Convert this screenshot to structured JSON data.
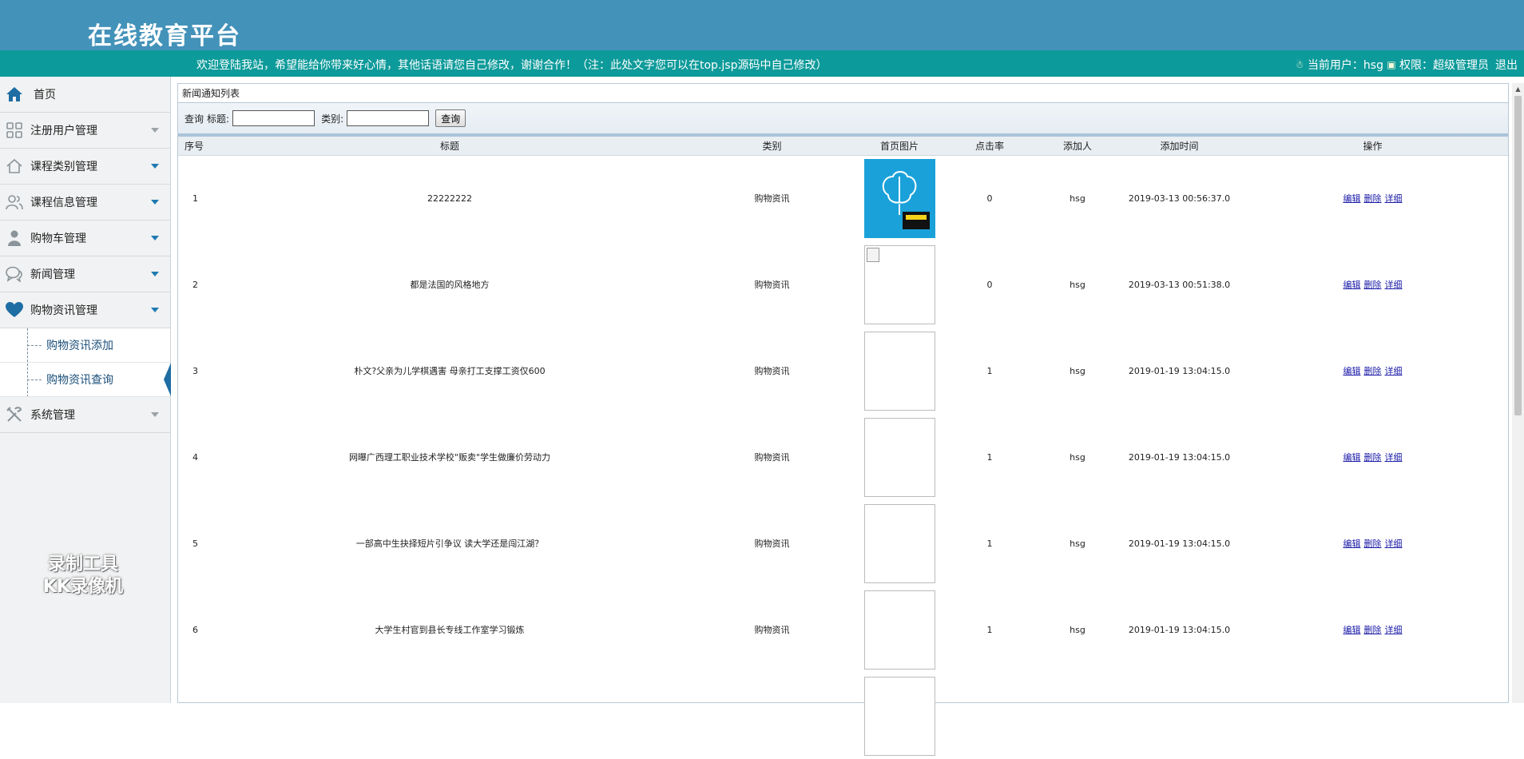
{
  "header": {
    "app_title": "在线教育平台",
    "welcome": "欢迎登陆我站，希望能给你带来好心情，其他话语请您自己修改，谢谢合作！（注：此处文字您可以在top.jsp源码中自己修改）",
    "current_user_label": "当前用户：hsg",
    "permission_label": "权限：超级管理员",
    "logout_label": "退出"
  },
  "sidebar": {
    "home": "首页",
    "items": [
      {
        "label": "注册用户管理",
        "icon": "grid-icon"
      },
      {
        "label": "课程类别管理",
        "icon": "home-icon"
      },
      {
        "label": "课程信息管理",
        "icon": "users-icon"
      },
      {
        "label": "购物车管理",
        "icon": "user-icon"
      },
      {
        "label": "新闻管理",
        "icon": "chat-icon"
      },
      {
        "label": "购物资讯管理",
        "icon": "heart-icon"
      }
    ],
    "sub_items": [
      "购物资讯添加",
      "购物资讯查询"
    ],
    "system": "系统管理"
  },
  "panel": {
    "title": "新闻通知列表",
    "search_label": "查询",
    "title_field_label": "标题:",
    "category_field_label": "类别:",
    "search_button": "查询"
  },
  "table": {
    "headers": [
      "序号",
      "标题",
      "类别",
      "首页图片",
      "点击率",
      "添加人",
      "添加时间",
      "操作"
    ],
    "actions": [
      "编辑",
      "删除",
      "详细"
    ],
    "rows": [
      {
        "seq": "1",
        "title": "22222222",
        "category": "购物资讯",
        "clicks": "0",
        "author": "hsg",
        "time": "2019-03-13 00:56:37.0"
      },
      {
        "seq": "2",
        "title": "都是法国的风格地方",
        "category": "购物资讯",
        "clicks": "0",
        "author": "hsg",
        "time": "2019-03-13 00:51:38.0"
      },
      {
        "seq": "3",
        "title": "朴文?父亲为儿学棋遇害 母亲打工支撑工资仅600",
        "category": "购物资讯",
        "clicks": "1",
        "author": "hsg",
        "time": "2019-01-19 13:04:15.0"
      },
      {
        "seq": "4",
        "title": "网曝广西理工职业技术学校\"贩卖\"学生做廉价劳动力",
        "category": "购物资讯",
        "clicks": "1",
        "author": "hsg",
        "time": "2019-01-19 13:04:15.0"
      },
      {
        "seq": "5",
        "title": "一部高中生抉择短片引争议 读大学还是闯江湖？",
        "category": "购物资讯",
        "clicks": "1",
        "author": "hsg",
        "time": "2019-01-19 13:04:15.0"
      },
      {
        "seq": "6",
        "title": "大学生村官到县长专线工作室学习锻炼",
        "category": "购物资讯",
        "clicks": "1",
        "author": "hsg",
        "time": "2019-01-19 13:04:15.0"
      }
    ]
  },
  "watermark": {
    "line1": "录制工具",
    "line2": "KK录像机"
  }
}
